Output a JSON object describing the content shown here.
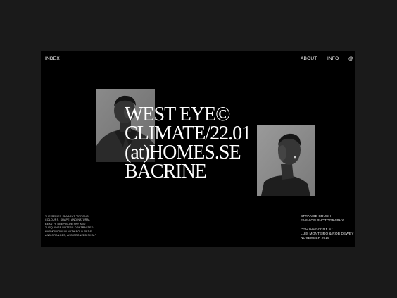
{
  "nav": {
    "index": "INDEX",
    "about": "ABOUT",
    "info": "INFO",
    "at": "@"
  },
  "headline": {
    "line1": "WEST EYE©",
    "line2": "CLIMATE/22.01",
    "line3": "(at)HOMES.SE",
    "line4": "BACRINE"
  },
  "description": "THE SERIES IS ABOUT \"STRONG COLOURS, SHAPE, AND NATURAL BEAUTY. DEEP BLUE SKY AND TURQUOISE WATERS CONTRASTED HARMONIOUSLY WITH BOLD REDS AND ORANGES, AND BRONZED SKIN.\"",
  "credits": {
    "title1": "STRANGE CRUSH",
    "title2": "FASHION PHOTOGRAPHY",
    "by_label": "PHOTOGRAPHY BY",
    "authors": "LUIS MONTEIRO & ROB DEWEY",
    "date": "NOVEMBER 2019"
  },
  "colors": {
    "outer_background": "#1a1a1a",
    "frame_background": "#000000",
    "text": "#ffffff"
  },
  "icons": {
    "portrait_left": "portrait-photo",
    "portrait_right": "portrait-photo"
  }
}
